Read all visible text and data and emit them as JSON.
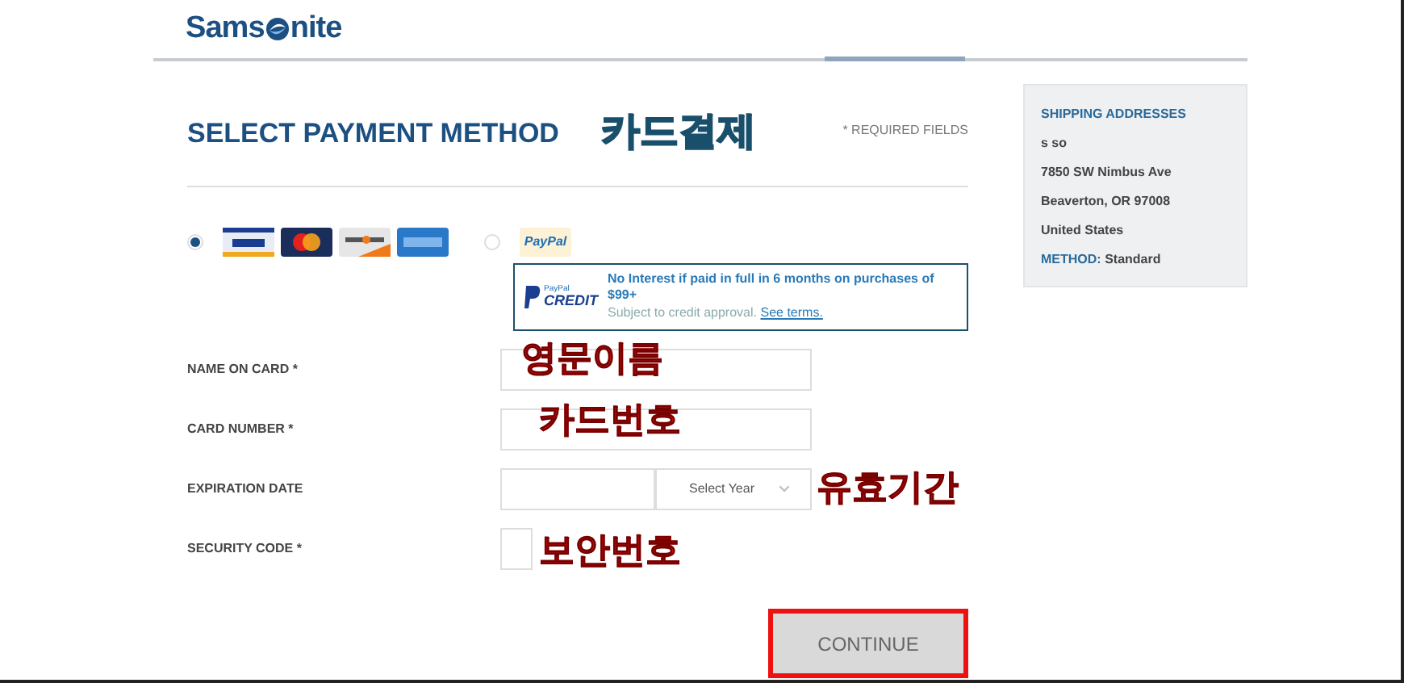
{
  "header": {
    "logo_left": "Sams",
    "logo_right": "nite"
  },
  "title": "SELECT PAYMENT METHOD",
  "title_annotation": "카드결제",
  "required_note": "* REQUIRED FIELDS",
  "payment_options": [
    {
      "kind": "cards",
      "selected": true
    },
    {
      "kind": "paypal",
      "selected": false,
      "logo": "PayPal"
    }
  ],
  "paypal_credit": {
    "logo_top": "PayPal",
    "logo_bottom": "CREDIT",
    "headline": "No Interest if paid in full in 6 months on purchases of $99+",
    "note": "Subject to credit approval.",
    "link": "See terms."
  },
  "fields": [
    {
      "label": "NAME ON CARD *",
      "kind": "text",
      "annotation": "영문이름"
    },
    {
      "label": "CARD NUMBER *",
      "kind": "text",
      "annotation": "카드번호"
    },
    {
      "label": "EXPIRATION DATE",
      "kind": "dates",
      "year": "Select Year",
      "annotation": "유효기간"
    },
    {
      "label": "SECURITY CODE *",
      "kind": "code",
      "annotation": "보안번호"
    }
  ],
  "continue_button": "CONTINUE",
  "shipping": {
    "heading": "SHIPPING ADDRESSES",
    "lines": [
      "s so",
      "7850 SW Nimbus Ave",
      "Beaverton, OR 97008",
      "United States"
    ],
    "method_label": "METHOD:",
    "method_value": "Standard"
  }
}
